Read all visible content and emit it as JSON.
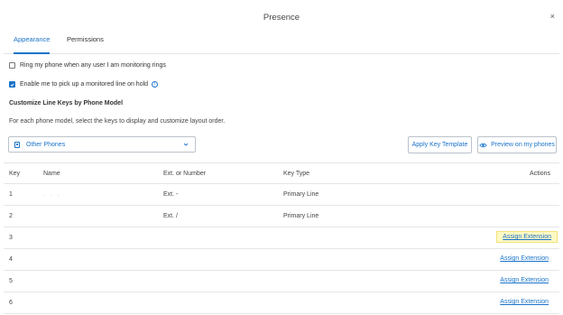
{
  "dialog": {
    "title": "Presence",
    "close_glyph": "×"
  },
  "tabs": [
    {
      "label": "Appearance",
      "active": true
    },
    {
      "label": "Permissions",
      "active": false
    }
  ],
  "options": {
    "ring_label": "Ring my phone when any user I am monitoring rings",
    "ring_checked": false,
    "pickup_label": "Enable me to pick up a monitored line on hold",
    "pickup_checked": true,
    "info_glyph": "i"
  },
  "customize": {
    "title": "Customize Line Keys by Phone Model",
    "description": "For each phone model, select the keys to display and customize layout order."
  },
  "phone_model": {
    "selected": "Other Phones",
    "icon": "phone-icon"
  },
  "buttons": {
    "apply_template": "Apply Key Template",
    "preview": "Preview on my phones"
  },
  "table": {
    "headers": {
      "key": "Key",
      "name": "Name",
      "ext": "Ext. or Number",
      "type": "Key Type",
      "actions": "Actions"
    },
    "rows": [
      {
        "key": "1",
        "name": ". . .",
        "ext": "Ext. -",
        "type": "Primary Line",
        "action": ""
      },
      {
        "key": "2",
        "name": "",
        "ext": "Ext. /",
        "type": "Primary Line",
        "action": ""
      },
      {
        "key": "3",
        "name": "",
        "ext": "",
        "type": "",
        "action": "Assign Extension",
        "highlight": true
      },
      {
        "key": "4",
        "name": "",
        "ext": "",
        "type": "",
        "action": "Assign Extension"
      },
      {
        "key": "5",
        "name": "",
        "ext": "",
        "type": "",
        "action": "Assign Extension"
      },
      {
        "key": "6",
        "name": "",
        "ext": "",
        "type": "",
        "action": "Assign Extension"
      }
    ]
  },
  "colors": {
    "accent": "#1a73c9",
    "border": "#e3e6ea",
    "highlight": "#fff9c4"
  }
}
